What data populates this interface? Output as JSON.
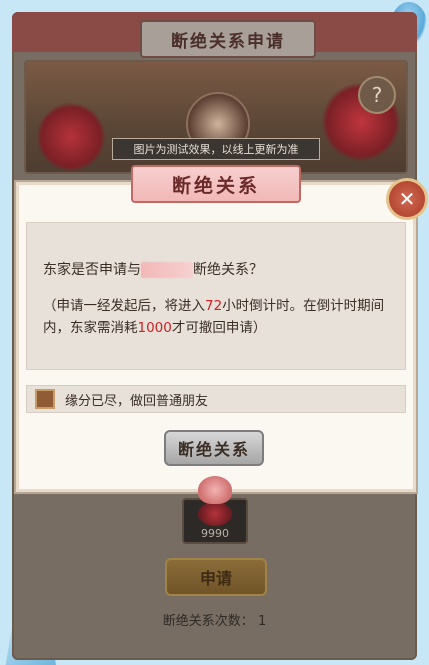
{
  "background": {
    "window_title": "断绝关系申请",
    "image_caption": "图片为测试效果，以线上更新为准",
    "help_icon": "question-mark-icon",
    "item_count": "9990",
    "apply_button": "申请",
    "break_count_label": "断绝关系次数：",
    "break_count_value": "1"
  },
  "modal": {
    "title": "断绝关系",
    "close_icon": "close-x-icon",
    "question_prefix": "东家是否申请与",
    "question_suffix": "断绝关系？",
    "note_part1": "（申请一经发起后，将进入",
    "note_hours": "72",
    "note_part2": "小时倒计时。在倒计时期间内，东家需消耗",
    "note_cost": "1000",
    "note_part3": "才可撤回申请）",
    "checkbox_label": "缘分已尽，做回普通朋友",
    "confirm_button": "断绝关系"
  },
  "colors": {
    "accent_red": "#d11f22",
    "modal_bg": "#fbf7f1",
    "page_bg": "#c7e7f7"
  }
}
